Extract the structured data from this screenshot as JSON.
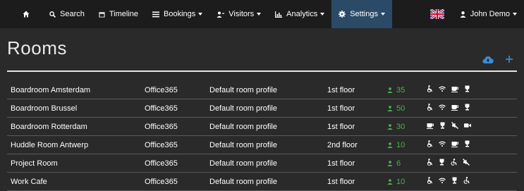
{
  "nav": {
    "items": [
      {
        "label": "",
        "icon": "home-icon"
      },
      {
        "label": "Search",
        "icon": "search-icon"
      },
      {
        "label": "Timeline",
        "icon": "calendar-icon"
      },
      {
        "label": "Bookings",
        "icon": "list-icon"
      },
      {
        "label": "Visitors",
        "icon": "visitor-icon"
      },
      {
        "label": "Analytics",
        "icon": "bar-chart-icon"
      },
      {
        "label": "Settings",
        "icon": "gear-icon"
      }
    ],
    "active": "Settings",
    "language_flag": "uk-flag-icon",
    "user_label": "John Demo"
  },
  "page": {
    "title": "Rooms"
  },
  "colors": {
    "accent": "#2b4a68",
    "capacity": "#4caf50",
    "upload": "#3a8fd9"
  },
  "rooms": [
    {
      "name": "Boardroom Amsterdam",
      "type": "Office365",
      "profile": "Default room profile",
      "floor": "1st floor",
      "capacity": "35",
      "features": [
        "wheelchair-icon",
        "wifi-icon",
        "coffee-icon",
        "trophy-icon"
      ]
    },
    {
      "name": "Boardroom Brussel",
      "type": "Office365",
      "profile": "Default room profile",
      "floor": "1st floor",
      "capacity": "50",
      "features": [
        "wheelchair-icon",
        "wifi-icon",
        "coffee-icon",
        "trophy-icon"
      ]
    },
    {
      "name": "Boardroom Rotterdam",
      "type": "Office365",
      "profile": "Default room profile",
      "floor": "1st floor",
      "capacity": "30",
      "features": [
        "coffee-icon",
        "trophy-icon",
        "no-sound-icon",
        "video-icon"
      ]
    },
    {
      "name": "Huddle Room Antwerp",
      "type": "Office365",
      "profile": "Default room profile",
      "floor": "2nd floor",
      "capacity": "10",
      "features": [
        "wheelchair-icon",
        "wifi-icon",
        "coffee-icon",
        "trophy-icon"
      ]
    },
    {
      "name": "Project Room",
      "type": "Office365",
      "profile": "Default room profile",
      "floor": "1st floor",
      "capacity": "6",
      "features": [
        "wheelchair-icon",
        "trophy-icon",
        "accessible-icon",
        "no-sound-icon"
      ]
    },
    {
      "name": "Work Cafe",
      "type": "Office365",
      "profile": "Default room profile",
      "floor": "1st floor",
      "capacity": "10",
      "features": [
        "wheelchair-icon",
        "wifi-icon",
        "trophy-icon",
        "accessible-icon"
      ]
    }
  ]
}
